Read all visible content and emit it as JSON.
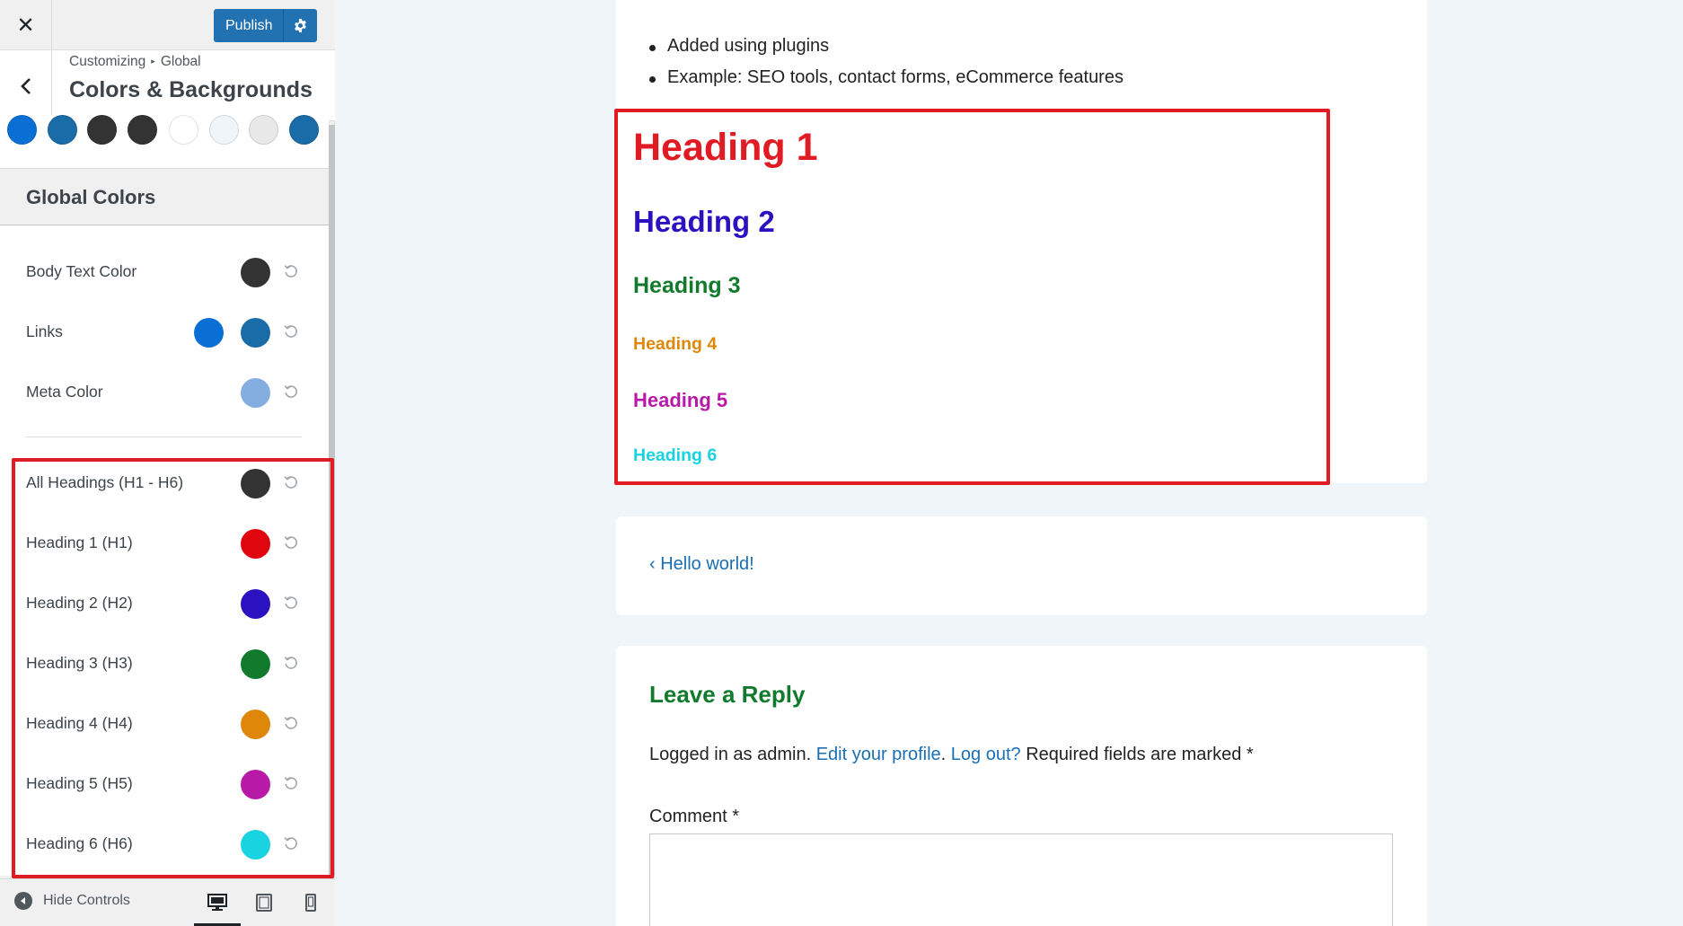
{
  "topbar": {
    "close_glyph": "✕",
    "publish_label": "Publish",
    "settings_icon": "gear-icon"
  },
  "section": {
    "breadcrumb_root": "Customizing",
    "breadcrumb_sep": "▸",
    "breadcrumb_leaf": "Global",
    "title": "Colors & Backgrounds"
  },
  "palette": [
    "#0a6fd4",
    "#1a6ca8",
    "#333333",
    "#333333",
    "#ffffff",
    "#f0f5fa",
    "#e8e8e8",
    "#1a6ca8"
  ],
  "global_colors": {
    "title": "Global Colors",
    "rows": [
      {
        "label": "Body Text Color",
        "colors": [
          "#333333"
        ]
      },
      {
        "label": "Links",
        "colors": [
          "#0a6fd4",
          "#1a6ca8"
        ]
      },
      {
        "label": "Meta Color",
        "colors": [
          "#84ade0"
        ]
      }
    ],
    "heading_rows": [
      {
        "label": "All Headings (H1 - H6)",
        "colors": [
          "#333333"
        ]
      },
      {
        "label": "Heading 1 (H1)",
        "colors": [
          "#e0060e"
        ]
      },
      {
        "label": "Heading 2 (H2)",
        "colors": [
          "#2b12c0"
        ]
      },
      {
        "label": "Heading 3 (H3)",
        "colors": [
          "#127a2c"
        ]
      },
      {
        "label": "Heading 4 (H4)",
        "colors": [
          "#de8708"
        ]
      },
      {
        "label": "Heading 5 (H5)",
        "colors": [
          "#b81aa7"
        ]
      },
      {
        "label": "Heading 6 (H6)",
        "colors": [
          "#1ad3e0"
        ]
      }
    ]
  },
  "footer": {
    "hide_controls_label": "Hide Controls",
    "devices": [
      "desktop-icon",
      "tablet-icon",
      "mobile-icon"
    ],
    "active_device": "desktop"
  },
  "preview": {
    "bullets": [
      "Added using plugins",
      "Example: SEO tools, contact forms, eCommerce features"
    ],
    "headings": {
      "h1": "Heading 1",
      "h2": "Heading 2",
      "h3": "Heading 3",
      "h4": "Heading 4",
      "h5": "Heading 5",
      "h6": "Heading 6"
    },
    "prev_post": "‹ Hello world!",
    "reply": {
      "title": "Leave a Reply",
      "logged_in_text": "Logged in as admin.",
      "edit_profile": "Edit your profile",
      "dot": ".",
      "log_out": "Log out?",
      "required_text": "Required fields are marked *",
      "comment_label": "Comment *"
    }
  },
  "accent_colors": {
    "highlight": "#e01b24",
    "button": "#2271b1"
  }
}
